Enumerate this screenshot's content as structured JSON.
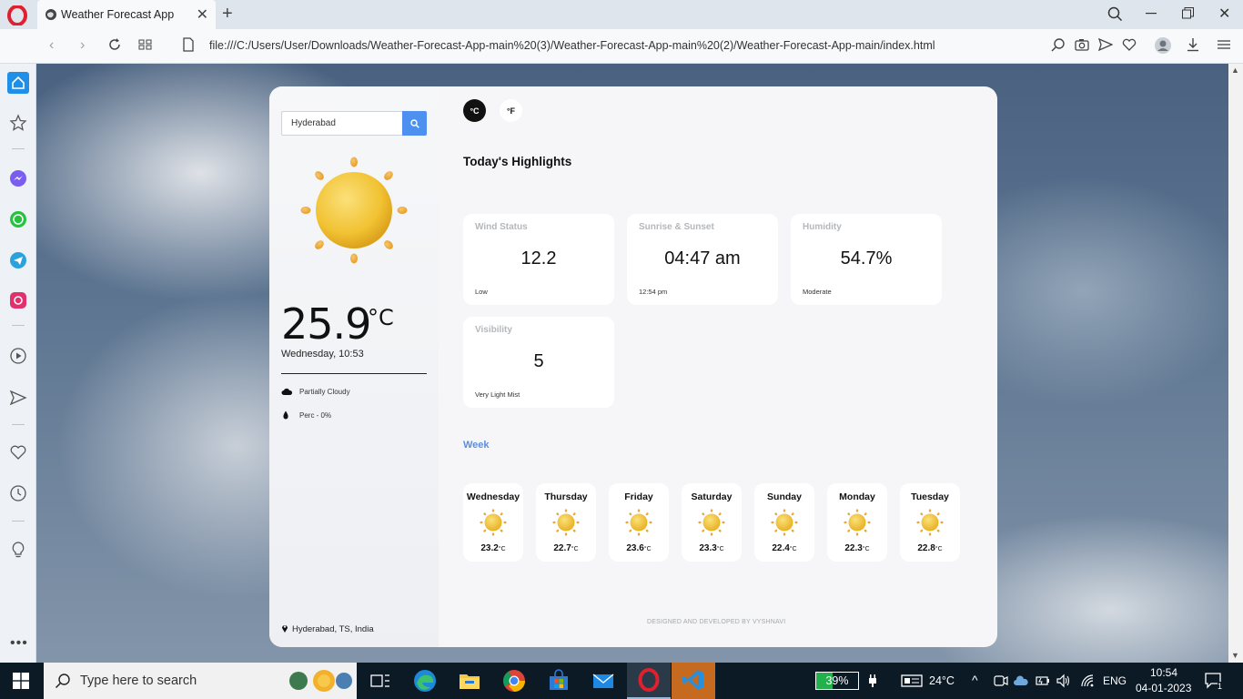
{
  "browser": {
    "tab_title": "Weather Forecast App",
    "url": "file:///C:/Users/User/Downloads/Weather-Forecast-App-main%20(3)/Weather-Forecast-App-main%20(2)/Weather-Forecast-App-main/index.html"
  },
  "weather": {
    "search_value": "Hyderabad",
    "temperature": "25.9",
    "temperature_unit": "°C",
    "datetime": "Wednesday, 10:53",
    "condition": "Partially Cloudy",
    "precipitation": "Perc - 0%",
    "location": "Hyderabad, TS, India",
    "unit_celsius": "°C",
    "unit_fahrenheit": "°F",
    "highlights_title": "Today's Highlights",
    "highlights": [
      {
        "title": "Wind Status",
        "value": "12.2",
        "status": "Low"
      },
      {
        "title": "Sunrise & Sunset",
        "value": "04:47 am",
        "status": "12:54 pm"
      },
      {
        "title": "Humidity",
        "value": "54.7%",
        "status": "Moderate"
      },
      {
        "title": "Visibility",
        "value": "5",
        "status": "Very Light Mist"
      }
    ],
    "week_title": "Week",
    "week": [
      {
        "day": "Wednesday",
        "temp": "23.2",
        "unit": "°C"
      },
      {
        "day": "Thursday",
        "temp": "22.7",
        "unit": "°C"
      },
      {
        "day": "Friday",
        "temp": "23.6",
        "unit": "°C"
      },
      {
        "day": "Saturday",
        "temp": "23.3",
        "unit": "°C"
      },
      {
        "day": "Sunday",
        "temp": "22.4",
        "unit": "°C"
      },
      {
        "day": "Monday",
        "temp": "22.3",
        "unit": "°C"
      },
      {
        "day": "Tuesday",
        "temp": "22.8",
        "unit": "°C"
      }
    ],
    "credit": "DESIGNED AND DEVELOPED BY VYSHNAVI"
  },
  "taskbar": {
    "search_placeholder": "Type here to search",
    "battery": "39%",
    "weather_temp": "24°C",
    "language": "ENG",
    "time": "10:54",
    "date": "04-01-2023",
    "notification_count": "1"
  }
}
